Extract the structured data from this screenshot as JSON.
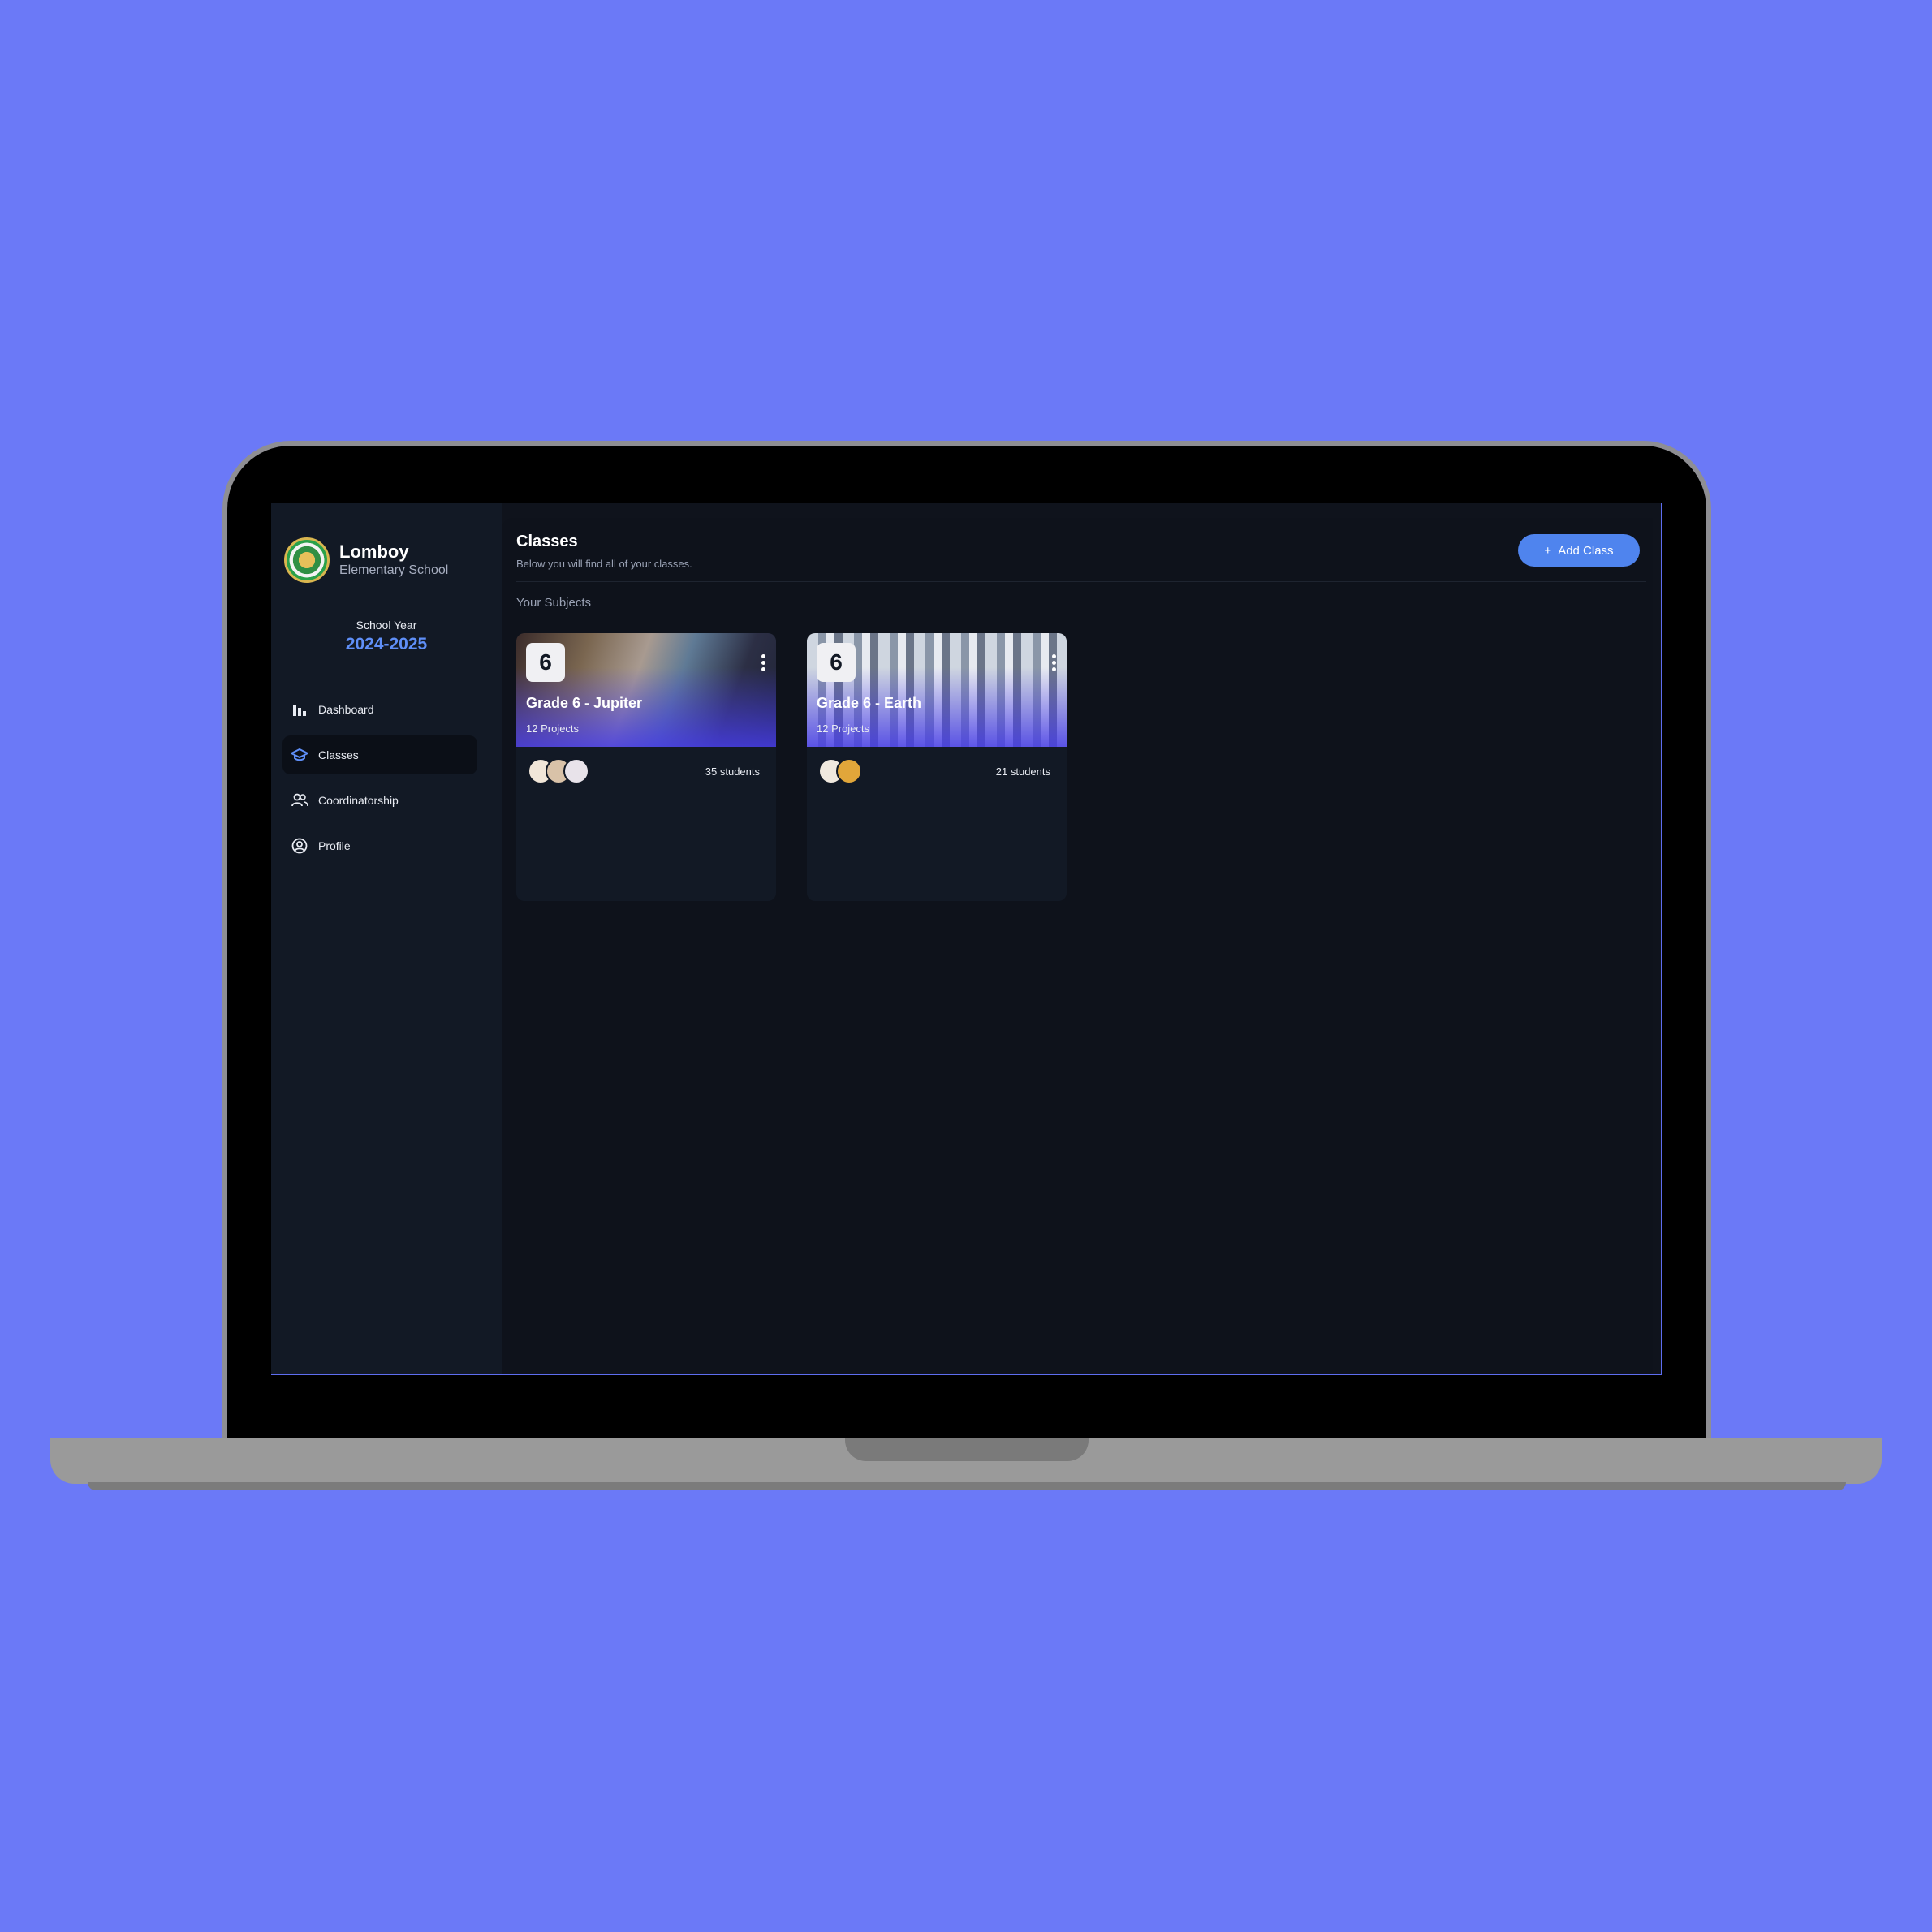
{
  "brand": {
    "name": "Lomboy",
    "subtitle": "Elementary School"
  },
  "school_year": {
    "label": "School Year",
    "value": "2024-2025"
  },
  "nav": {
    "items": [
      {
        "label": "Dashboard",
        "icon": "bar-chart-icon",
        "active": false
      },
      {
        "label": "Classes",
        "icon": "graduation-cap-icon",
        "active": true
      },
      {
        "label": "Coordinatorship",
        "icon": "users-icon",
        "active": false
      },
      {
        "label": "Profile",
        "icon": "user-circle-icon",
        "active": false
      }
    ]
  },
  "header": {
    "title": "Classes",
    "subtitle": "Below you will find all of your classes.",
    "add_button": "Add Class"
  },
  "section": {
    "label": "Your Subjects"
  },
  "classes": [
    {
      "grade": "6",
      "name": "Grade 6 - Jupiter",
      "projects": "12 Projects",
      "students": "35 students"
    },
    {
      "grade": "6",
      "name": "Grade 6 - Earth",
      "projects": "12 Projects",
      "students": "21 students"
    }
  ],
  "colors": {
    "background": "#6b79f7",
    "accent": "#4f84ee",
    "school_year": "#5f8ff8",
    "panel": "#0e121b",
    "sidebar": "#121925"
  }
}
